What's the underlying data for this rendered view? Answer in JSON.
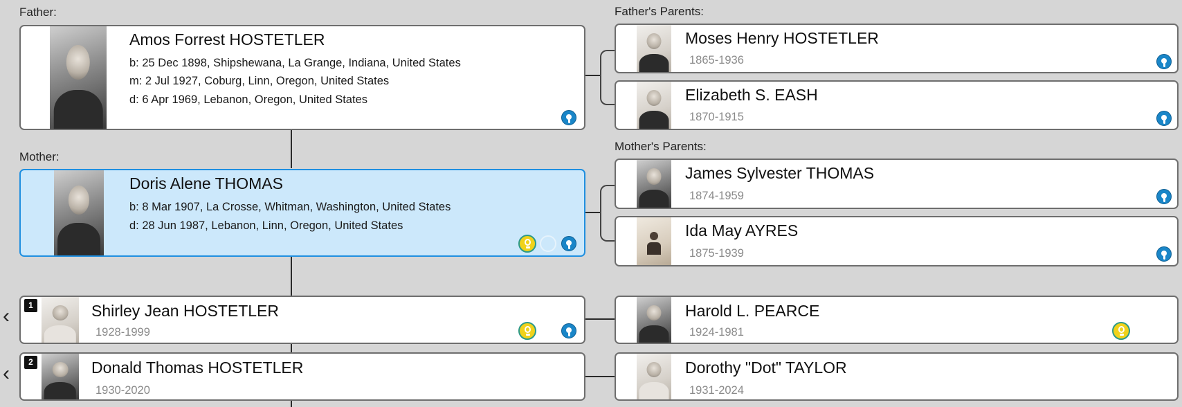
{
  "labels": {
    "father": "Father:",
    "mother": "Mother:",
    "fathers_parents": "Father's Parents:",
    "mothers_parents": "Mother's Parents:"
  },
  "father": {
    "name": "Amos Forrest HOSTETLER",
    "birth": "b: 25 Dec 1898, Shipshewana, La Grange, Indiana, United States",
    "marriage": "m: 2 Jul 1927, Coburg, Linn, Oregon, United States",
    "death": "d: 6 Apr 1969, Lebanon, Oregon, United States",
    "icons": [
      "familysearch-icon"
    ]
  },
  "mother": {
    "name": "Doris Alene THOMAS",
    "birth": "b: 8 Mar 1907, La Crosse, Whitman, Washington, United States",
    "death": "d: 28 Jun 1987, Lebanon, Linn, Oregon, United States",
    "selected": true,
    "icons": [
      "hint-icon",
      "familysearch-icon"
    ]
  },
  "fathers_parents": [
    {
      "name": "Moses Henry HOSTETLER",
      "dates": "1865-1936",
      "icons": [
        "familysearch-icon"
      ]
    },
    {
      "name": "Elizabeth S. EASH",
      "dates": "1870-1915",
      "icons": [
        "familysearch-icon"
      ]
    }
  ],
  "mothers_parents": [
    {
      "name": "James Sylvester THOMAS",
      "dates": "1874-1959",
      "icons": [
        "familysearch-icon"
      ]
    },
    {
      "name": "Ida May AYRES",
      "dates": "1875-1939",
      "icons": [
        "familysearch-icon"
      ]
    }
  ],
  "children": [
    {
      "number": "1",
      "name": "Shirley Jean HOSTETLER",
      "dates": "1928-1999",
      "icons": [
        "hint-icon",
        "familysearch-icon"
      ]
    },
    {
      "number": "2",
      "name": "Donald Thomas HOSTETLER",
      "dates": "1930-2020",
      "icons": []
    }
  ],
  "spouses": [
    {
      "name": "Harold L. PEARCE",
      "dates": "1924-1981",
      "icons": [
        "hint-icon"
      ]
    },
    {
      "name": "Dorothy \"Dot\" TAYLOR",
      "dates": "1931-2024",
      "icons": []
    }
  ],
  "colors": {
    "background": "#d6d6d6",
    "selected_fill": "#cce8fb",
    "selected_border": "#1f8fe0",
    "familysearch_icon": "#1a86c8",
    "hint_icon": "#f0d21b"
  }
}
